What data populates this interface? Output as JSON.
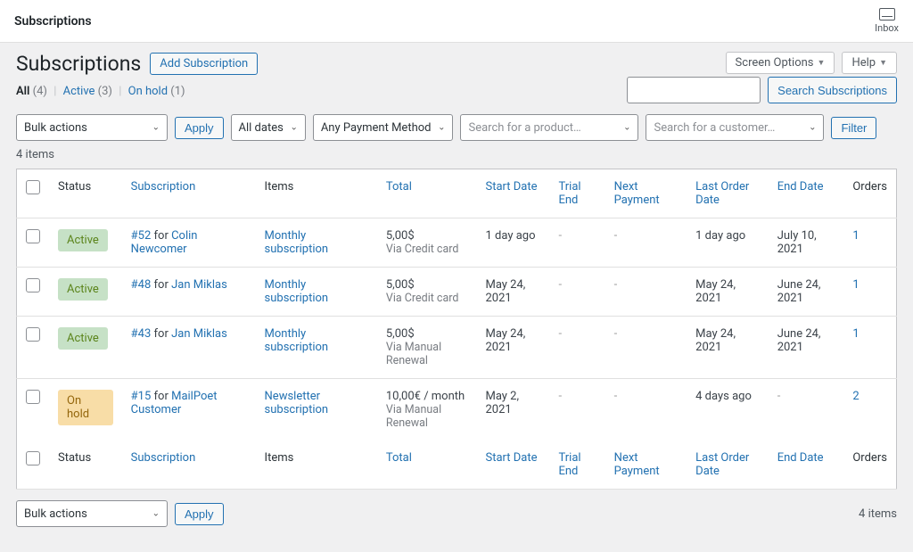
{
  "topbar": {
    "title": "Subscriptions",
    "inbox_label": "Inbox"
  },
  "page": {
    "title": "Subscriptions",
    "add_btn": "Add Subscription"
  },
  "header_buttons": {
    "screen_options": "Screen Options",
    "help": "Help"
  },
  "filters": {
    "all_label": "All",
    "all_count": "(4)",
    "active_label": "Active",
    "active_count": "(3)",
    "onhold_label": "On hold",
    "onhold_count": "(1)"
  },
  "search": {
    "button": "Search Subscriptions"
  },
  "tablenav": {
    "bulk_actions": "Bulk actions",
    "apply": "Apply",
    "all_dates": "All dates",
    "any_payment": "Any Payment Method",
    "product_ph": "Search for a product…",
    "customer_ph": "Search for a customer…",
    "filter": "Filter",
    "items": "4 items"
  },
  "columns": {
    "status": "Status",
    "subscription": "Subscription",
    "items": "Items",
    "total": "Total",
    "start": "Start Date",
    "trial": "Trial End",
    "next": "Next Payment",
    "last": "Last Order Date",
    "end": "End Date",
    "orders": "Orders"
  },
  "rows": [
    {
      "status": "Active",
      "status_class": "status-active",
      "sub_id": "#52",
      "sub_for": " for ",
      "sub_cust": "Colin Newcomer",
      "item": "Monthly subscription",
      "total": "5,00$",
      "via": "Via Credit card",
      "start": "1 day ago",
      "trial": "-",
      "next": "-",
      "last": "1 day ago",
      "end": "July 10, 2021",
      "orders": "1"
    },
    {
      "status": "Active",
      "status_class": "status-active",
      "sub_id": "#48",
      "sub_for": " for ",
      "sub_cust": "Jan Miklas",
      "item": "Monthly subscription",
      "total": "5,00$",
      "via": "Via Credit card",
      "start": "May 24, 2021",
      "trial": "-",
      "next": "-",
      "last": "May 24, 2021",
      "end": "June 24, 2021",
      "orders": "1"
    },
    {
      "status": "Active",
      "status_class": "status-active",
      "sub_id": "#43",
      "sub_for": " for ",
      "sub_cust": "Jan Miklas",
      "item": "Monthly subscription",
      "total": "5,00$",
      "via": "Via Manual Renewal",
      "start": "May 24, 2021",
      "trial": "-",
      "next": "-",
      "last": "May 24, 2021",
      "end": "June 24, 2021",
      "orders": "1"
    },
    {
      "status": "On hold",
      "status_class": "status-onhold",
      "sub_id": "#15",
      "sub_for": " for ",
      "sub_cust": "MailPoet Customer",
      "item": "Newsletter subscription",
      "total": "10,00€ / month",
      "via": "Via Manual Renewal",
      "start": "May 2, 2021",
      "trial": "-",
      "next": "-",
      "last": "4 days ago",
      "end": "-",
      "orders": "2"
    }
  ]
}
